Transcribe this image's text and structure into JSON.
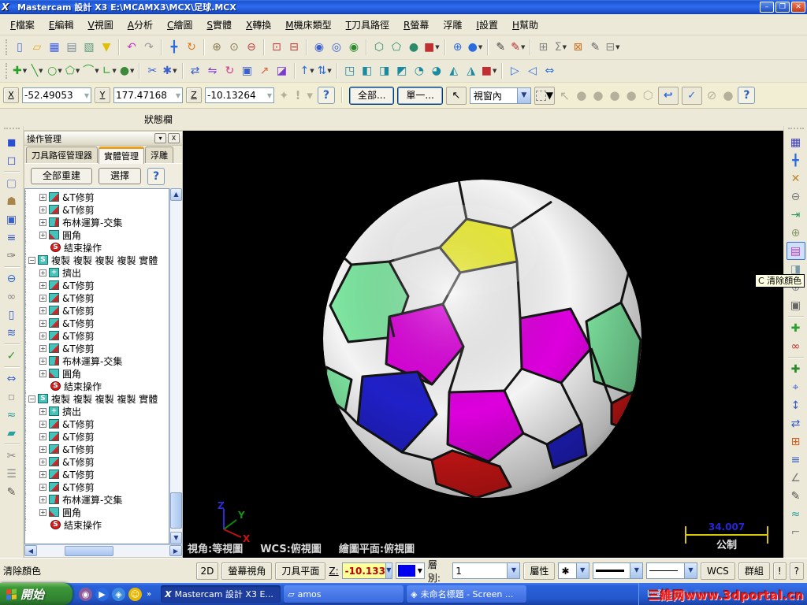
{
  "titlebar": {
    "title": "Mastercam 設計 X3  E:\\MCAMX3\\MCX\\足球.MCX",
    "min_label": "–",
    "max_label": "❐",
    "close_label": "✕"
  },
  "menubar": {
    "items": [
      {
        "h": "F",
        "l": "檔案"
      },
      {
        "h": "E",
        "l": "編輯"
      },
      {
        "h": "V",
        "l": "視圖"
      },
      {
        "h": "A",
        "l": "分析"
      },
      {
        "h": "C",
        "l": "繪圖"
      },
      {
        "h": "S",
        "l": "實體"
      },
      {
        "h": "X",
        "l": "轉換"
      },
      {
        "h": "M",
        "l": "機床類型"
      },
      {
        "h": "T",
        "l": "刀具路徑"
      },
      {
        "h": "R",
        "l": "螢幕"
      },
      {
        "h": "",
        "l": "浮雕"
      },
      {
        "h": "I",
        "l": "設置"
      },
      {
        "h": "H",
        "l": "幫助"
      }
    ]
  },
  "toolbar_row1": [
    {
      "hd": 1
    },
    {
      "n": "new-file",
      "g": "▯",
      "c": "#4a6fd8"
    },
    {
      "n": "open-file",
      "g": "▱",
      "c": "#e8a820"
    },
    {
      "n": "save",
      "g": "▦",
      "c": "#3c5ae8"
    },
    {
      "n": "print",
      "g": "▤",
      "c": "#7a8a99"
    },
    {
      "n": "print-preview",
      "g": "▧",
      "c": "#5a9a7a"
    },
    {
      "n": "filter",
      "g": "▼",
      "c": "#e0c000"
    },
    {
      "sp": 1
    },
    {
      "n": "undo",
      "g": "↶",
      "c": "#c03cc0"
    },
    {
      "n": "redo",
      "g": "↷",
      "c": "#9a9a9a"
    },
    {
      "sp": 1
    },
    {
      "n": "pan",
      "g": "╋",
      "c": "#2b6be0"
    },
    {
      "n": "dynamic-rotate",
      "g": "↻",
      "c": "#e07820"
    },
    {
      "sp": 1
    },
    {
      "n": "zoom-in",
      "g": "⊕",
      "c": "#8a7a50"
    },
    {
      "n": "zoom-window",
      "g": "⊙",
      "c": "#8a7a50"
    },
    {
      "n": "zoom-out",
      "g": "⊖",
      "c": "#c04040"
    },
    {
      "sp": 1
    },
    {
      "n": "zoom-target",
      "g": "⊡",
      "c": "#c04040"
    },
    {
      "n": "zoom-previous",
      "g": "⊟",
      "c": "#c04040"
    },
    {
      "sp": 1
    },
    {
      "n": "find-entity",
      "g": "◉",
      "c": "#3a5fd0"
    },
    {
      "n": "find-chain",
      "g": "◎",
      "c": "#3a5fd0"
    },
    {
      "n": "find-check",
      "g": "◉",
      "c": "#2a8a2a"
    },
    {
      "sp": 1
    },
    {
      "n": "gview-isometric",
      "g": "⬡",
      "c": "#2a8a6a"
    },
    {
      "n": "gview-wireframe",
      "g": "⬠",
      "c": "#2a8a6a"
    },
    {
      "n": "gview-shaded",
      "g": "●",
      "c": "#2a8a6a"
    },
    {
      "n": "material",
      "g": "■",
      "c": "#c03030",
      "d": 1
    },
    {
      "sp": 1
    },
    {
      "n": "globe-view",
      "g": "⊕",
      "c": "#2b6be0"
    },
    {
      "n": "plane-select",
      "g": "●",
      "c": "#2b6be0",
      "d": 1
    },
    {
      "sp": 1
    },
    {
      "n": "pen",
      "g": "✎",
      "c": "#444444"
    },
    {
      "n": "pen-delete",
      "g": "✎",
      "c": "#b03030",
      "d": 1
    },
    {
      "sp": 1
    },
    {
      "n": "grid",
      "g": "⊞",
      "c": "#888888"
    },
    {
      "n": "sigma",
      "g": "Σ",
      "c": "#888888",
      "d": 1
    },
    {
      "n": "net",
      "g": "⊠",
      "c": "#d07020"
    },
    {
      "n": "sketch",
      "g": "✎",
      "c": "#666666"
    },
    {
      "n": "panel-toggle",
      "g": "⊟",
      "c": "#888888",
      "d": 1
    }
  ],
  "toolbar_row2": [
    {
      "hd": 1
    },
    {
      "n": "create-point",
      "g": "✚",
      "c": "#2ca02c",
      "d": 1
    },
    {
      "n": "create-line",
      "g": "╲",
      "c": "#2ca02c",
      "d": 1
    },
    {
      "n": "create-arc",
      "g": "○",
      "c": "#2ca02c",
      "d": 1
    },
    {
      "n": "create-polygon",
      "g": "⬠",
      "c": "#2ca02c",
      "d": 1
    },
    {
      "n": "create-fillet",
      "g": "⌒",
      "c": "#2ca02c",
      "d": 1
    },
    {
      "n": "create-polyline",
      "g": "∟",
      "c": "#2ca02c",
      "d": 1
    },
    {
      "n": "create-sphere",
      "g": "●",
      "c": "#3a8a3a",
      "d": 1
    },
    {
      "sp": 1
    },
    {
      "n": "trim-tool",
      "g": "✂",
      "c": "#3a5fd0"
    },
    {
      "n": "break-point",
      "g": "✱",
      "c": "#3a5fd0",
      "d": 1
    },
    {
      "sp": 1
    },
    {
      "n": "xform-translate",
      "g": "⇄",
      "c": "#3a5fd0"
    },
    {
      "n": "xform-mirror",
      "g": "⇋",
      "c": "#7a3ad0"
    },
    {
      "n": "xform-rotate",
      "g": "↻",
      "c": "#d03a8a"
    },
    {
      "n": "xform-offset",
      "g": "▣",
      "c": "#3a5fd0"
    },
    {
      "n": "xform-scale",
      "g": "↗",
      "c": "#d06a3a"
    },
    {
      "n": "xform-project",
      "g": "◪",
      "c": "#7a3ad0"
    },
    {
      "sp": 1
    },
    {
      "n": "level-up",
      "g": "↑",
      "c": "#2b6be0",
      "d": 1
    },
    {
      "n": "level-swap",
      "g": "⇅",
      "c": "#2b6be0",
      "d": 1
    },
    {
      "sp": 1
    },
    {
      "n": "solid-extrude",
      "g": "◳",
      "c": "#1a8aa0"
    },
    {
      "n": "solid-loft",
      "g": "◧",
      "c": "#1a8aa0"
    },
    {
      "n": "solid-sweep",
      "g": "◨",
      "c": "#1a8aa0"
    },
    {
      "n": "solid-boolean",
      "g": "◩",
      "c": "#1a8aa0"
    },
    {
      "n": "solid-fillet",
      "g": "◔",
      "c": "#1a8aa0"
    },
    {
      "n": "solid-shell",
      "g": "◕",
      "c": "#1a8aa0"
    },
    {
      "n": "solid-trim",
      "g": "◭",
      "c": "#1a8aa0"
    },
    {
      "n": "solid-draft",
      "g": "◮",
      "c": "#1a8aa0"
    },
    {
      "n": "solid-red-cube",
      "g": "■",
      "c": "#c03030",
      "d": 1
    },
    {
      "sp": 1
    },
    {
      "n": "cplane-next",
      "g": "▷",
      "c": "#2b6be0"
    },
    {
      "n": "cplane-prev",
      "g": "◁",
      "c": "#2b6be0"
    },
    {
      "n": "cplane-normal",
      "g": "⇔",
      "c": "#2b6be0"
    }
  ],
  "ribbon": {
    "x_label": "X",
    "x_value": "-52.49053",
    "y_label": "Y",
    "y_value": "177.47168",
    "z_label": "Z",
    "z_value": "-10.13264",
    "help_label": "?",
    "all_button": "全部...",
    "single_button": "單一...",
    "mode_select": "視窗內"
  },
  "status_label": "狀態欄",
  "left_strip": [
    {
      "hd": 1
    },
    {
      "n": "solids-cube",
      "g": "◼",
      "c": "#2b4fd0"
    },
    {
      "n": "solids-cube-wire",
      "g": "◻",
      "c": "#2b4fd0"
    },
    {
      "sp": 1
    },
    {
      "n": "curve-rect",
      "g": "▢",
      "c": "#7a8ad0"
    },
    {
      "n": "stamp",
      "g": "☗",
      "c": "#a8854a"
    },
    {
      "n": "spiral",
      "g": "▣",
      "c": "#3a5fd0"
    },
    {
      "n": "layers",
      "g": "≡",
      "c": "#3a5fd0"
    },
    {
      "n": "brush",
      "g": "✑",
      "c": "#777777"
    },
    {
      "sp": 1
    },
    {
      "n": "ellipse",
      "g": "⊖",
      "c": "#2b6be0"
    },
    {
      "n": "chain",
      "g": "∞",
      "c": "#888888"
    },
    {
      "n": "cylinder",
      "g": "▯",
      "c": "#3a5fd0"
    },
    {
      "n": "spring",
      "g": "≋",
      "c": "#3a5fd0"
    },
    {
      "sp": 1
    },
    {
      "n": "check-plant",
      "g": "✓",
      "c": "#2a9a2a"
    },
    {
      "sp": 1
    },
    {
      "n": "fit-width",
      "g": "⇔",
      "c": "#3a5fd0"
    },
    {
      "n": "dashed-box",
      "g": "▫",
      "c": "#999999"
    },
    {
      "n": "waves",
      "g": "≈",
      "c": "#2aa0a0"
    },
    {
      "n": "surface",
      "g": "▰",
      "c": "#2aa0a0"
    },
    {
      "sp": 1
    },
    {
      "n": "knife",
      "g": "✂",
      "c": "#888888"
    },
    {
      "n": "comb",
      "g": "☰",
      "c": "#888888"
    },
    {
      "n": "pen-tool",
      "g": "✎",
      "c": "#555555"
    }
  ],
  "right_strip": [
    {
      "hd": 1
    },
    {
      "n": "save-file",
      "g": "▦",
      "c": "#3c3cc8"
    },
    {
      "n": "pan-view",
      "g": "╋",
      "c": "#2b6be0"
    },
    {
      "n": "dynamic-spin",
      "g": "✕",
      "c": "#b8862a"
    },
    {
      "n": "zoom-minus",
      "g": "⊖",
      "c": "#777777"
    },
    {
      "n": "exit-view",
      "g": "⇥",
      "c": "#2a9a5a"
    },
    {
      "n": "wireframe-sphere",
      "g": "⊕",
      "c": "#8a9a6a"
    },
    {
      "n": "color-cycle",
      "g": "▤",
      "c": "#c03cc0",
      "hl": 1
    },
    {
      "n": "clear-color",
      "g": "◨",
      "c": "#789aaa"
    },
    {
      "n": "shade-sphere",
      "g": "⊕",
      "c": "#888888"
    },
    {
      "n": "camera",
      "g": "▣",
      "c": "#666666"
    },
    {
      "sp": 1
    },
    {
      "n": "add-entity",
      "g": "✚",
      "c": "#2ca02c"
    },
    {
      "n": "glasses",
      "g": "∞",
      "c": "#c03030"
    },
    {
      "sp": 1
    },
    {
      "n": "add-point",
      "g": "✚",
      "c": "#2a8a2a"
    },
    {
      "n": "telescope",
      "g": "⌖",
      "c": "#3a5fd0"
    },
    {
      "n": "move-vertical",
      "g": "↕",
      "c": "#3a5fd0"
    },
    {
      "n": "move-horizontal",
      "g": "⇄",
      "c": "#3a5fd0"
    },
    {
      "n": "grid-snap",
      "g": "⊞",
      "c": "#d06020"
    },
    {
      "n": "list-view",
      "g": "≡",
      "c": "#3a5fd0"
    },
    {
      "n": "angle-measure",
      "g": "∠",
      "c": "#777777"
    },
    {
      "n": "pen-edit",
      "g": "✎",
      "c": "#555555"
    },
    {
      "n": "wave-surface",
      "g": "≈",
      "c": "#2aa0a0"
    },
    {
      "n": "ruler",
      "g": "⌐",
      "c": "#888888"
    }
  ],
  "panel": {
    "title": "操作管理",
    "collapse_label": "▾",
    "close_label": "X",
    "tabs": [
      {
        "label": "刀具路徑管理器",
        "active": false
      },
      {
        "label": "實體管理",
        "active": true
      },
      {
        "label": "浮雕",
        "active": false
      }
    ],
    "rebuild_button": "全部重建",
    "select_button": "選擇",
    "help_label": "?",
    "tree": [
      {
        "icon": "trim",
        "label": "&T修剪",
        "expand": "plus",
        "level": 1
      },
      {
        "icon": "trim",
        "label": "&T修剪",
        "expand": "plus",
        "level": 1
      },
      {
        "icon": "bool",
        "label": "布林運算-交集",
        "expand": "plus",
        "level": 1
      },
      {
        "icon": "fillet",
        "label": "圓角",
        "expand": "plus",
        "level": 1
      },
      {
        "icon": "stop",
        "label": "結束操作",
        "expand": "none",
        "level": 1
      },
      {
        "icon": "group",
        "label": "複製 複製 複製 複製 實體",
        "expand": "minus",
        "level": 0
      },
      {
        "icon": "extrude",
        "label": "擠出",
        "expand": "plus",
        "level": 1
      },
      {
        "icon": "trim",
        "label": "&T修剪",
        "expand": "plus",
        "level": 1
      },
      {
        "icon": "trim",
        "label": "&T修剪",
        "expand": "plus",
        "level": 1
      },
      {
        "icon": "trim",
        "label": "&T修剪",
        "expand": "plus",
        "level": 1
      },
      {
        "icon": "trim",
        "label": "&T修剪",
        "expand": "plus",
        "level": 1
      },
      {
        "icon": "trim",
        "label": "&T修剪",
        "expand": "plus",
        "level": 1
      },
      {
        "icon": "trim",
        "label": "&T修剪",
        "expand": "plus",
        "level": 1
      },
      {
        "icon": "bool",
        "label": "布林運算-交集",
        "expand": "plus",
        "level": 1
      },
      {
        "icon": "fillet",
        "label": "圓角",
        "expand": "plus",
        "level": 1
      },
      {
        "icon": "stop",
        "label": "結束操作",
        "expand": "none",
        "level": 1
      },
      {
        "icon": "group",
        "label": "複製 複製 複製 複製 實體",
        "expand": "minus",
        "level": 0
      },
      {
        "icon": "extrude",
        "label": "擠出",
        "expand": "plus",
        "level": 1
      },
      {
        "icon": "trim",
        "label": "&T修剪",
        "expand": "plus",
        "level": 1
      },
      {
        "icon": "trim",
        "label": "&T修剪",
        "expand": "plus",
        "level": 1
      },
      {
        "icon": "trim",
        "label": "&T修剪",
        "expand": "plus",
        "level": 1
      },
      {
        "icon": "trim",
        "label": "&T修剪",
        "expand": "plus",
        "level": 1
      },
      {
        "icon": "trim",
        "label": "&T修剪",
        "expand": "plus",
        "level": 1
      },
      {
        "icon": "trim",
        "label": "&T修剪",
        "expand": "plus",
        "level": 1
      },
      {
        "icon": "bool",
        "label": "布林運算-交集",
        "expand": "plus",
        "level": 1
      },
      {
        "icon": "fillet",
        "label": "圓角",
        "expand": "plus",
        "level": 1
      },
      {
        "icon": "stop",
        "label": "結束操作",
        "expand": "none",
        "level": 1
      }
    ]
  },
  "viewport": {
    "view_status": "視角:等視圖",
    "wcs_status": "WCS:俯視圖",
    "cplane_status": "繪圖平面:俯視圖",
    "scale_value": "34.007",
    "scale_units": "公制",
    "axis_x": "X",
    "axis_y": "Y",
    "axis_z": "Z"
  },
  "tooltip": {
    "text": "C 清除顏色"
  },
  "bottombar": {
    "status": "清除顏色",
    "dim_button": "2D",
    "screen_view_button": "螢幕視角",
    "tool_plane_button": "刀具平面",
    "z_label": "Z:",
    "z_value": "-10.133",
    "level_label": "層別:",
    "level_value": "1",
    "attr_button": "屬性",
    "point_style": "✱",
    "wcs_button": "WCS",
    "group_button": "群組",
    "warn_button": "!",
    "help_button": "?"
  },
  "taskbar": {
    "start_label": "開始",
    "quick_launch": [
      {
        "n": "quick-launch-media",
        "g": "◉",
        "c": "#8a5a9a"
      },
      {
        "n": "quick-launch-player",
        "g": "▶",
        "c": "#2a6ae0"
      },
      {
        "n": "quick-launch-browser",
        "g": "◈",
        "c": "#3a8ae0"
      },
      {
        "n": "quick-launch-messenger",
        "g": "☺",
        "c": "#e8b800"
      }
    ],
    "more_label": "»",
    "tasks": [
      {
        "label": "Mastercam 設計 X3 E...",
        "icon": "X",
        "active": true
      },
      {
        "label": "amos",
        "icon": "▱",
        "active": false
      },
      {
        "label": "未命名標題 - Screen ...",
        "icon": "◈",
        "active": false
      }
    ],
    "watermark": "三維网www.3dportal.cn"
  },
  "ball": {
    "colors": {
      "white": "#f4f4f4",
      "yellow": "#efef00",
      "magenta": "#dd00dd",
      "green": "#7fe8a2",
      "blue": "#2020c8",
      "red": "#d41616",
      "line": "#141414"
    }
  }
}
